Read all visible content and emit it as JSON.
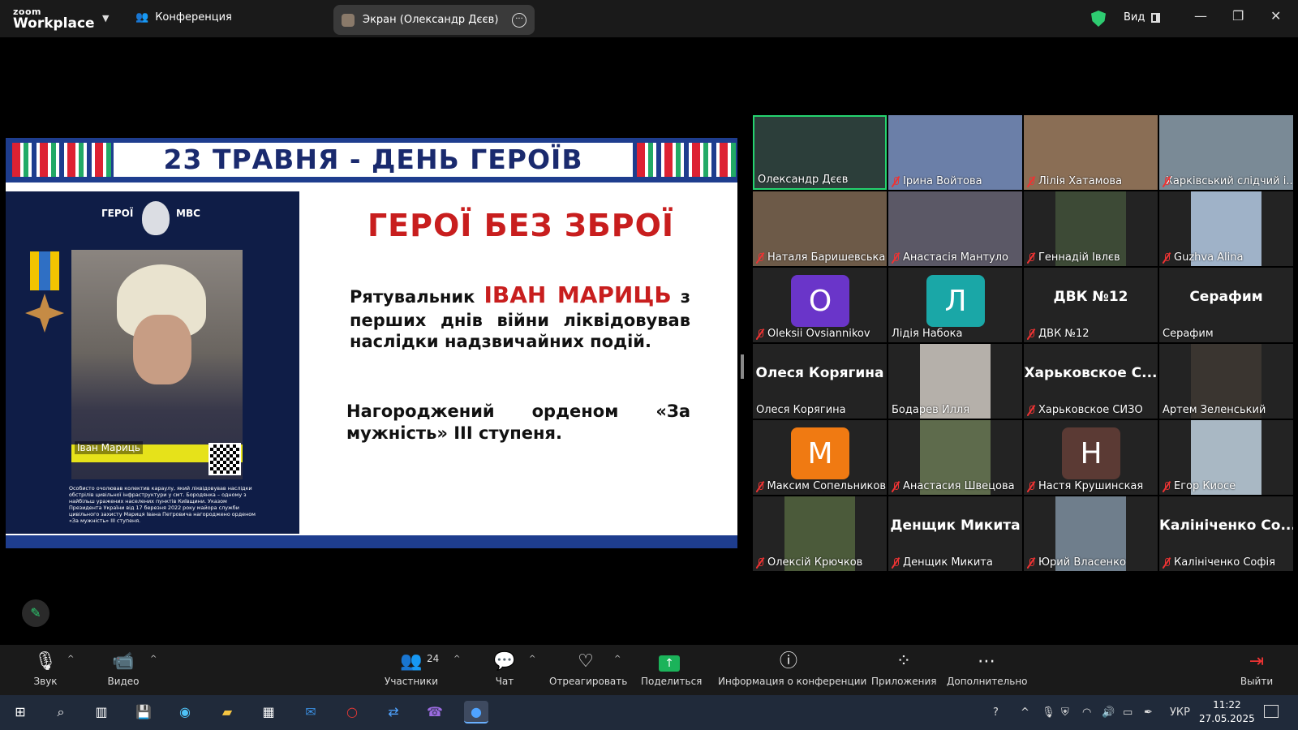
{
  "titlebar": {
    "logo_line1": "zoom",
    "logo_line2": "Workplace",
    "meeting_label": "Конференция",
    "screen_share_label": "Экран (Олександр Дєєв)",
    "view_label": "Вид"
  },
  "slide": {
    "header": "23 ТРАВНЯ - ДЕНЬ ГЕРОЇВ",
    "poster_brand_left": "ГЕРОЇ",
    "poster_brand_right": "МВС",
    "poster_name": "Іван Мариць",
    "poster_desc": "Особисто очолював колектив караулу, який ліквідовував наслідки обстрілів цивільної інфраструктури у смт. Бородянка – одному з найбільш уражених населених пунктів Київщини. Указом Президента України від 17 березня 2022 року майора служби цивільного захисту Мариця Івана Петровича нагороджено орденом «За мужність» ІІІ ступеня.",
    "title": "ГЕРОЇ БЕЗ ЗБРОЇ",
    "p1_prefix": "Рятувальник ",
    "p1_name": "ІВАН МАРИЦЬ",
    "p1_rest": " з перших днів війни ліквідовував наслідки надзвичайних подій.",
    "p2": "Нагороджений орденом «За мужність» ІІІ ступеня."
  },
  "participants": [
    {
      "name": "Олександр Дєєв",
      "kind": "video",
      "color": "#2c3e3a",
      "muted": false,
      "active": true
    },
    {
      "name": "Ірина Войтова",
      "kind": "video",
      "color": "#6b7fa8",
      "muted": true
    },
    {
      "name": "Лілія Хатамова",
      "kind": "video",
      "color": "#8a6e55",
      "muted": true
    },
    {
      "name": "Харківський слідчий і...",
      "kind": "video",
      "color": "#7a8a96",
      "muted": true
    },
    {
      "name": "Наталя Баришевська",
      "kind": "video",
      "color": "#6d5a48",
      "muted": true
    },
    {
      "name": "Анастасія Мантуло",
      "kind": "video",
      "color": "#5b5866",
      "muted": true
    },
    {
      "name": "Геннадій Івлєв",
      "kind": "video_center",
      "color": "#3d4a36",
      "muted": true
    },
    {
      "name": "Guzhva Alina",
      "kind": "video_center",
      "color": "#9fb2c8",
      "muted": true
    },
    {
      "name": "Oleksii Ovsiannikov",
      "kind": "letter",
      "letter": "O",
      "color": "#6a35c9",
      "muted": true
    },
    {
      "name": "Лідія Набока",
      "kind": "letter",
      "letter": "Л",
      "color": "#1aa7a7",
      "muted": false
    },
    {
      "name": "ДВК №12",
      "kind": "text",
      "big": "ДВК №12",
      "muted": true
    },
    {
      "name": "Серафим",
      "kind": "text",
      "big": "Серафим",
      "muted": false
    },
    {
      "name": "Олеся Корягина",
      "kind": "text",
      "big": "Олеся Корягина",
      "muted": false
    },
    {
      "name": "Бодарев Илля",
      "kind": "video_center",
      "color": "#b5b0aa",
      "muted": false
    },
    {
      "name": "Харьковское СИЗО",
      "kind": "text",
      "big": "Харьковское С...",
      "muted": true
    },
    {
      "name": "Артем Зеленський",
      "kind": "video_center",
      "color": "#3a3530",
      "muted": false
    },
    {
      "name": "Максим Сопельников",
      "kind": "letter",
      "letter": "М",
      "color": "#f07a12",
      "muted": true
    },
    {
      "name": "Анастасия Швецова",
      "kind": "video_center",
      "color": "#5e6b4c",
      "muted": true
    },
    {
      "name": "Настя Крушинская",
      "kind": "letter",
      "letter": "Н",
      "color": "#5b3a34",
      "muted": true
    },
    {
      "name": "Егор Киосе",
      "kind": "video_center",
      "color": "#a9b8c4",
      "muted": true
    },
    {
      "name": "Олексій Крючков",
      "kind": "video_center",
      "color": "#4b5a3a",
      "muted": true
    },
    {
      "name": "Денщик Микита",
      "kind": "text",
      "big": "Денщик Микита",
      "muted": true
    },
    {
      "name": "Юрий Власенко",
      "kind": "video_center",
      "color": "#6f7e8c",
      "muted": true
    },
    {
      "name": "Калініченко Софія",
      "kind": "text",
      "big": "Калініченко Со...",
      "muted": true
    }
  ],
  "toolbar": {
    "audio": "Звук",
    "video": "Видео",
    "participants": "Участники",
    "participants_count": "24",
    "chat": "Чат",
    "react": "Отреагировать",
    "share": "Поделиться",
    "info": "Информация о конференции",
    "apps": "Приложения",
    "more": "Дополнительно",
    "leave": "Выйти"
  },
  "taskbar": {
    "lang": "УКР",
    "time": "11:22",
    "date": "27.05.2025"
  },
  "icons": {
    "accent_green": "#25d36f",
    "share_green": "#1bb35a",
    "muted_red": "#e33"
  }
}
